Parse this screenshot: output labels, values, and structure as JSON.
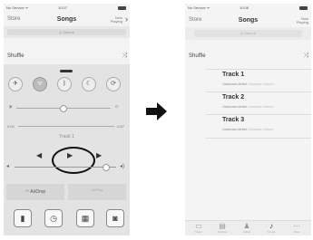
{
  "left_phone": {
    "status": {
      "carrier": "No Service ᯤ",
      "time": "10:07"
    },
    "nav": {
      "back": "Store",
      "title": "Songs",
      "now_playing": "Now Playing"
    },
    "search_placeholder": "Q Search",
    "shuffle_label": "Shuffle",
    "control_center": {
      "toggles": [
        {
          "icon": "airplane-icon",
          "glyph": "✈"
        },
        {
          "icon": "wifi-icon",
          "glyph": "ᯤ"
        },
        {
          "icon": "bluetooth-icon",
          "glyph": "ᛒ"
        },
        {
          "icon": "do-not-disturb-icon",
          "glyph": "☾"
        },
        {
          "icon": "rotation-lock-icon",
          "glyph": "⟳"
        }
      ],
      "brightness_level": 0.5,
      "time_elapsed": "0:00",
      "time_remaining": "-0:57",
      "track_title": "Track 1",
      "volume_level": 0.9,
      "airdrop_label": "AirDrop",
      "airplay_label": "AirPlay",
      "quick_launch": [
        {
          "icon": "flashlight-icon",
          "glyph": "▮"
        },
        {
          "icon": "timer-icon",
          "glyph": "◷"
        },
        {
          "icon": "calculator-icon",
          "glyph": "▦"
        },
        {
          "icon": "camera-icon",
          "glyph": "◙"
        }
      ]
    }
  },
  "right_phone": {
    "status": {
      "carrier": "No Service ᯤ",
      "time": "10:06"
    },
    "nav": {
      "back": "Store",
      "title": "Songs",
      "now_playing": "Now Playing"
    },
    "search_placeholder": "Q Search",
    "shuffle_label": "Shuffle",
    "tracks": [
      {
        "title": "Track 1",
        "artist": "Unknown Artist",
        "album": "Unknown Album"
      },
      {
        "title": "Track 2",
        "artist": "Unknown Artist",
        "album": "Unknown Album"
      },
      {
        "title": "Track 3",
        "artist": "Unknown Artist",
        "album": "Unknown Album"
      }
    ],
    "tabs": [
      {
        "label": "Music",
        "icon": "music-icon"
      },
      {
        "label": "Playlists",
        "icon": "playlists-icon"
      },
      {
        "label": "Artists",
        "icon": "artists-icon"
      },
      {
        "label": "Songs",
        "icon": "songs-icon"
      },
      {
        "label": "More",
        "icon": "more-icon"
      }
    ]
  }
}
